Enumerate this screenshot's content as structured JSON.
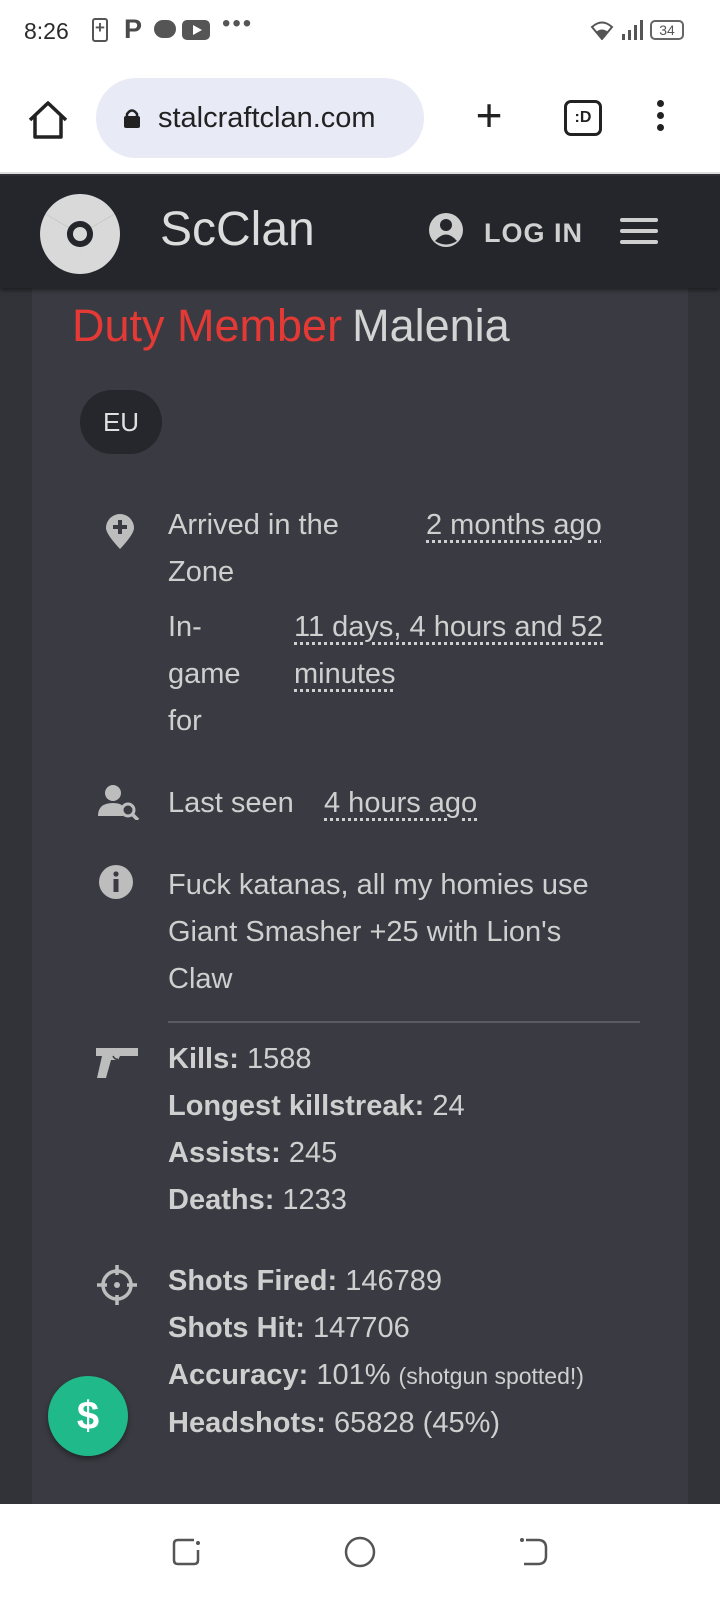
{
  "status_bar": {
    "time": "8:26",
    "more_indicator": "•••",
    "battery_level": "34",
    "icons": [
      "battery-charging-icon",
      "p-app-icon",
      "chat-icon",
      "youtube-icon",
      "wifi-icon",
      "signal-icon",
      "battery-icon"
    ]
  },
  "browser": {
    "url": "stalcraftclan.com",
    "tabs_label": ":D",
    "new_tab_symbol": "+"
  },
  "site_nav": {
    "title": "ScClan",
    "login_label": "LOG IN",
    "colors": {
      "background": "#25262c",
      "text": "#dcdcdc"
    }
  },
  "profile": {
    "rank": "Duty Member",
    "name": "Malenia",
    "region": "EU",
    "arrived_label": "Arrived in the Zone",
    "arrived_value": "2 months ago",
    "ingame_label": "In-game for",
    "ingame_value": "11 days, 4 hours and 52 minutes",
    "last_seen_label": "Last seen",
    "last_seen_value": "4 hours ago",
    "motto": "Fuck katanas, all my homies use Giant Smasher +25 with Lion's Claw",
    "colors": {
      "rank": "#e53935",
      "card": "#3a3b42"
    }
  },
  "combat_stats": [
    {
      "label": "Kills:",
      "value": "1588"
    },
    {
      "label": "Longest killstreak:",
      "value": "24"
    },
    {
      "label": "Assists:",
      "value": "245"
    },
    {
      "label": "Deaths:",
      "value": "1233"
    }
  ],
  "shooting_stats": [
    {
      "label": "Shots Fired:",
      "value": "146789",
      "note": ""
    },
    {
      "label": "Shots Hit:",
      "value": "147706",
      "note": ""
    },
    {
      "label": "Accuracy:",
      "value": "101%",
      "note": "(shotgun spotted!)"
    },
    {
      "label": "Headshots:",
      "value": "65828 (45%)",
      "note": ""
    }
  ],
  "donate": {
    "symbol": "$",
    "color": "#1fb98a"
  }
}
